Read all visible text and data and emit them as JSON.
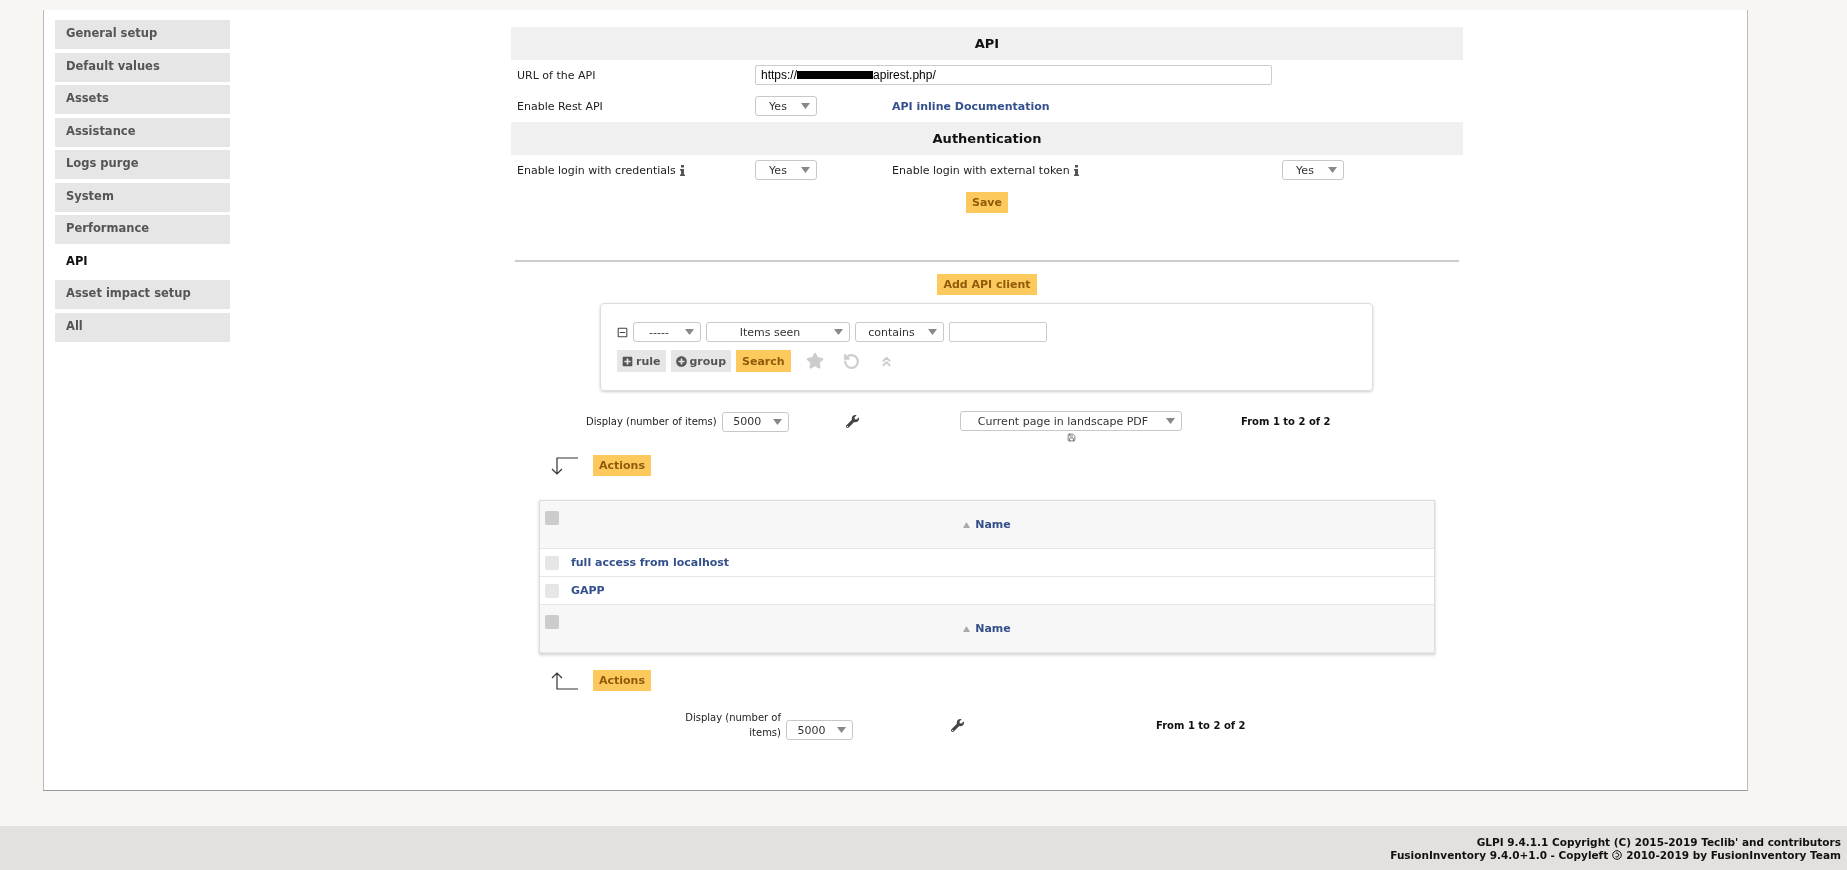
{
  "sidebar": {
    "items": [
      {
        "label": "General setup",
        "selected": false
      },
      {
        "label": "Default values",
        "selected": false
      },
      {
        "label": "Assets",
        "selected": false
      },
      {
        "label": "Assistance",
        "selected": false
      },
      {
        "label": "Logs purge",
        "selected": false
      },
      {
        "label": "System",
        "selected": false
      },
      {
        "label": "Performance",
        "selected": false
      },
      {
        "label": "API",
        "selected": true
      },
      {
        "label": "Asset impact setup",
        "selected": false
      },
      {
        "label": "All",
        "selected": false
      }
    ]
  },
  "api_section": {
    "title": "API",
    "url_label": "URL of the API",
    "url_prefix": "https://",
    "url_suffix": "apirest.php/",
    "rest_label": "Enable Rest API",
    "rest_value": "Yes",
    "doc_link": "API inline Documentation"
  },
  "auth_section": {
    "title": "Authentication",
    "credentials_label": "Enable login with credentials",
    "credentials_value": "Yes",
    "token_label": "Enable login with external token",
    "token_value": "Yes",
    "save_button": "Save"
  },
  "add_client_button": "Add API client",
  "search": {
    "link": "-----",
    "field": "Items seen",
    "operator": "contains",
    "rule_button": "rule",
    "group_button": "group",
    "search_button": "Search"
  },
  "display_top": {
    "label": "Display (number of items)",
    "value": "5000",
    "export": "Current page in landscape PDF",
    "pager": "From 1 to 2 of 2"
  },
  "actions_top": "Actions",
  "table": {
    "select_all_checked": false,
    "footer_select_all_checked": false,
    "column": "Name",
    "rows": [
      {
        "name": "full access from localhost",
        "checked": false
      },
      {
        "name": "GAPP",
        "checked": false
      }
    ],
    "footer_column": "Name"
  },
  "actions_bottom": "Actions",
  "display_bottom": {
    "label": "Display (number of items)",
    "value": "5000",
    "pager": "From 1 to 2 of 2"
  },
  "footer": {
    "line1": "GLPI 9.4.1.1 Copyright (C) 2015-2019 Teclib' and contributors",
    "line2_before": "FusionInventory 9.4.0+1.0 - Copyleft",
    "line2_after": "2010-2019 by FusionInventory Team"
  }
}
